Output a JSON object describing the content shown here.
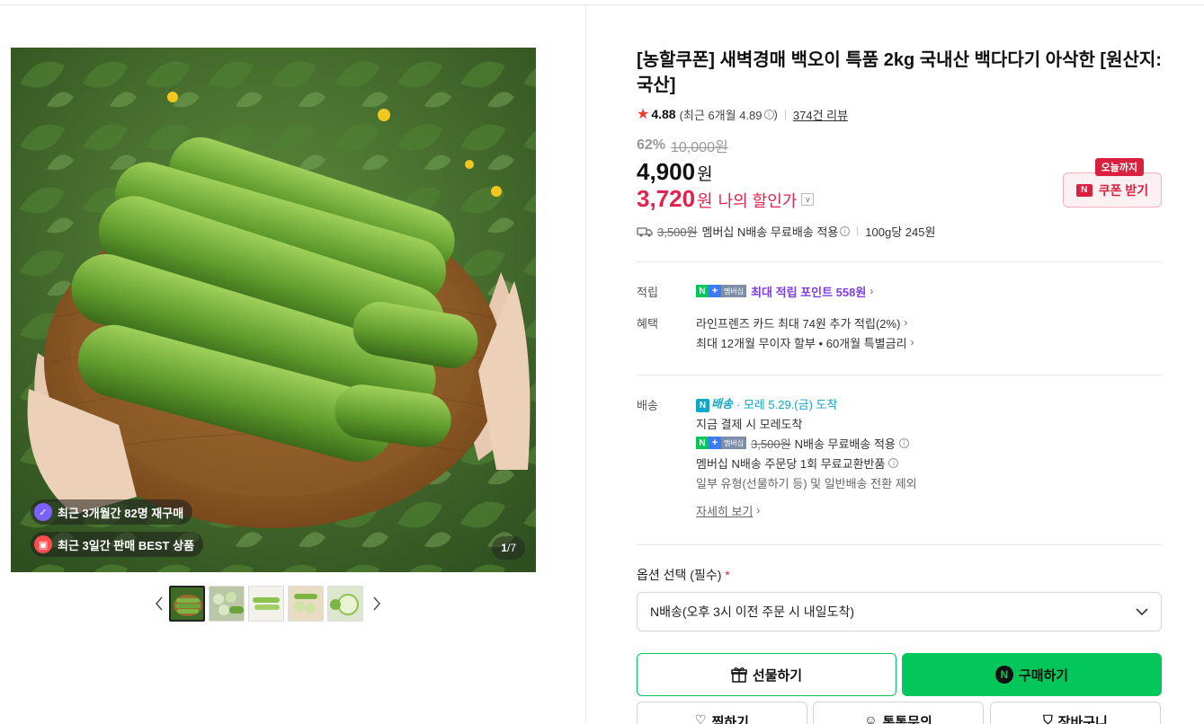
{
  "image_panel": {
    "badges": [
      "최근 3개월간 82명 재구매",
      "최근 3일간 판매 BEST 상품"
    ],
    "counter_current": "1",
    "counter_total": "/7",
    "thumbnails": [
      "thumb-1",
      "thumb-2",
      "thumb-3",
      "thumb-4",
      "thumb-5"
    ]
  },
  "product": {
    "title": "[농할쿠폰] 새벽경매 백오이 특품 2kg 국내산 백다다기 아삭한 [원산지:국산]",
    "rating": "4.88",
    "rating_recent": "(최근 6개월 4.89",
    "rating_recent_close": ")",
    "reviews": "374건 리뷰",
    "discount_rate": "62%",
    "original_price": "10,000원",
    "price": "4,900",
    "price_unit": "원",
    "my_price": "3,720",
    "my_price_unit": "원",
    "my_price_label": "나의 할인가",
    "coupon_tag": "오늘까지",
    "coupon_btn": "쿠폰 받기",
    "ship_original": "3,500원",
    "ship_text": "멤버십 N배송 무료배송 적용",
    "unit_price": "100g당 245원"
  },
  "benefits": {
    "points_label": "적립",
    "membership_badge": "멤버십",
    "points_text": "최대 적립 포인트 558원",
    "benefit_label": "혜택",
    "benefit_lines": [
      "라인프렌즈 카드 최대 74원 추가 적립(2%)",
      "최대 12개월 무이자 할부 • 60개월 특별금리"
    ]
  },
  "delivery": {
    "label": "배송",
    "nship": "배송",
    "eta": "· 모레 5.29.(금) 도착",
    "pay_now": "지금 결제 시 모레도착",
    "ship_original": "3,500원",
    "ship_text": "N배송 무료배송 적용",
    "exchange": "멤버십 N배송 주문당 1회 무료교환반품",
    "exclusion": "일부 유형(선물하기 등) 및 일반배송 전환 제외",
    "more": "자세히 보기"
  },
  "options": {
    "label": "옵션 선택 (필수)",
    "required_mark": "*",
    "selected": "N배송(오후 3시 이전 주문 시 내일도착)"
  },
  "actions": {
    "gift": "선물하기",
    "buy": "구매하기",
    "wish": "찜하기",
    "talk": "톡톡문의",
    "cart": "장바구니"
  },
  "colors": {
    "accent_green": "#03c75a",
    "discount_red": "#e0224c",
    "points_purple": "#7b3fe4",
    "delivery_teal": "#12a5c9"
  }
}
